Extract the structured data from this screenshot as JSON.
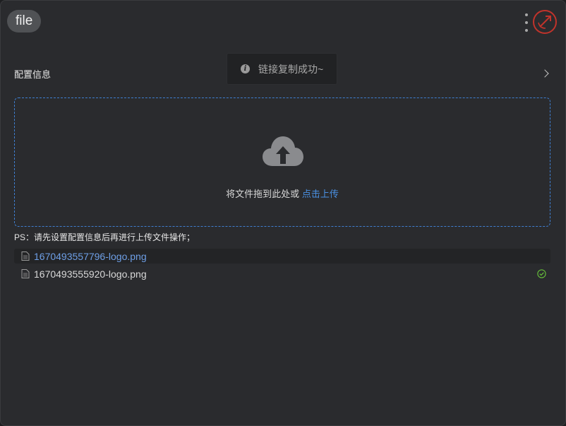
{
  "header": {
    "title": "file"
  },
  "toast": {
    "message": "链接复制成功~",
    "icon": "info-icon"
  },
  "config": {
    "label": "配置信息"
  },
  "upload": {
    "hint": "将文件拖到此处或",
    "link": "点击上传",
    "border_color": "#3f7fd1"
  },
  "note": "PS：请先设置配置信息后再进行上传文件操作；",
  "files": [
    {
      "name": "1670493557796-logo.png",
      "active": true,
      "uploaded": false
    },
    {
      "name": "1670493555920-logo.png",
      "active": false,
      "uploaded": true
    }
  ],
  "colors": {
    "accent": "#4a90e2",
    "success": "#67c23a",
    "logo_red": "#c0332b"
  }
}
